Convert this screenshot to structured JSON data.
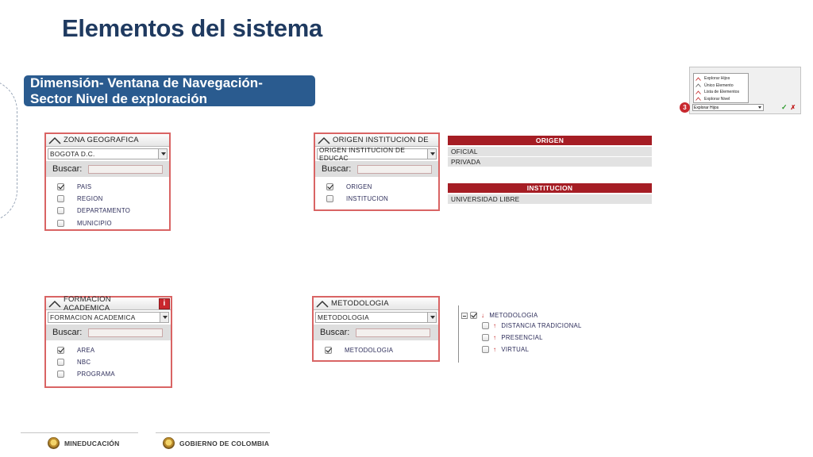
{
  "page": {
    "title": "Elementos del sistema",
    "subtitle_line1": "Dimensión- Ventana de Navegación-",
    "subtitle_line2": "Sector Nivel de exploración"
  },
  "widgets": {
    "zona": {
      "header": "ZONA GEOGRAFICA",
      "select_value": "BOGOTA D.C.",
      "search_label": "Buscar:",
      "items": [
        {
          "label": "PAIS",
          "checked": true
        },
        {
          "label": "REGION",
          "checked": false
        },
        {
          "label": "DEPARTAMENTO",
          "checked": false
        },
        {
          "label": "MUNICIPIO",
          "checked": false
        }
      ]
    },
    "origen": {
      "header": "ORIGEN INSTITUCION DE",
      "select_value": "ORIGEN INSTITUCION DE EDUCAC",
      "search_label": "Buscar:",
      "items": [
        {
          "label": "ORIGEN",
          "checked": true
        },
        {
          "label": "INSTITUCION",
          "checked": false
        }
      ]
    },
    "formacion": {
      "header": "FORMACION ACADEMICA",
      "info": "i",
      "select_value": "FORMACION ACADEMICA",
      "search_label": "Buscar:",
      "items": [
        {
          "label": "AREA",
          "checked": true
        },
        {
          "label": "NBC",
          "checked": false
        },
        {
          "label": "PROGRAMA",
          "checked": false
        }
      ]
    },
    "metodologia": {
      "header": "METODOLOGIA",
      "select_value": "METODOLOGIA",
      "search_label": "Buscar:",
      "items": [
        {
          "label": "METODOLOGIA",
          "checked": true
        }
      ]
    }
  },
  "tables": {
    "origen": {
      "header": "ORIGEN",
      "rows": [
        "OFICIAL",
        "PRIVADA"
      ]
    },
    "institucion": {
      "header": "INSTITUCION",
      "rows": [
        "UNIVERSIDAD LIBRE"
      ]
    }
  },
  "tree": {
    "root": "METODOLOGIA",
    "children": [
      "DISTANCIA TRADICIONAL",
      "PRESENCIAL",
      "VIRTUAL"
    ]
  },
  "mini_menu": {
    "items": [
      "Explorar Hijos",
      "Único Elemento",
      "Lista de Elementos",
      "Explorar Nivel"
    ],
    "badge": "3",
    "select_value": "Explorar Hijos",
    "ok": "✓",
    "cancel": "✗"
  },
  "footer": {
    "left": "MINEDUCACIÓN",
    "right": "GOBIERNO DE COLOMBIA"
  },
  "colors": {
    "title": "#1f3a60",
    "subtitle_bg": "#2a5b8f",
    "panel_border": "#d96464",
    "table_header": "#a51d24"
  }
}
